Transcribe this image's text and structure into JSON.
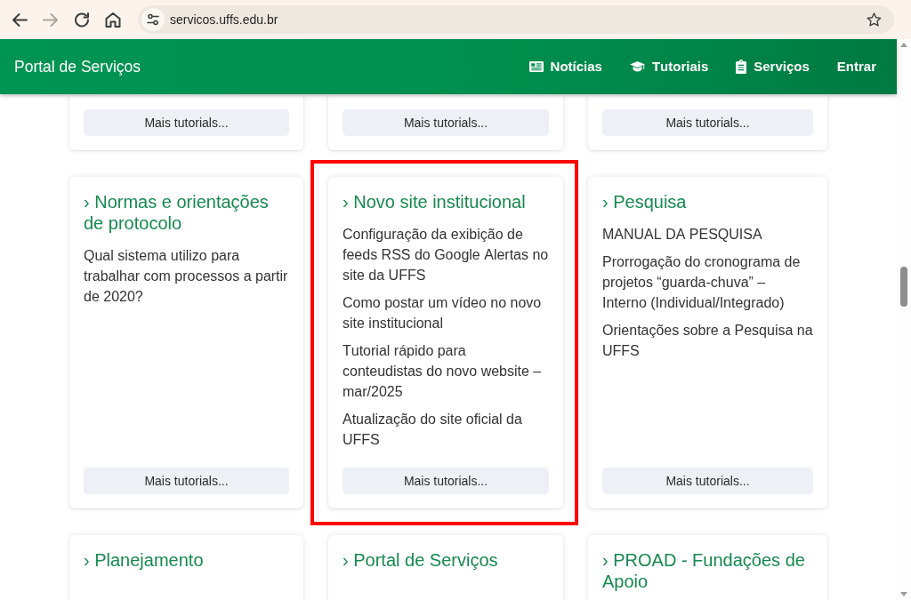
{
  "browser": {
    "nav_buttons": [
      {
        "kind": "back",
        "disabled": false
      },
      {
        "kind": "forward",
        "disabled": true
      },
      {
        "kind": "reload",
        "disabled": false
      },
      {
        "kind": "home",
        "disabled": false
      }
    ],
    "url": "servicos.uffs.edu.br",
    "bookmarked": false
  },
  "navbar": {
    "brand": "Portal de Serviços",
    "links": [
      {
        "label": "Notícias"
      },
      {
        "label": "Tutoriais"
      },
      {
        "label": "Serviços"
      },
      {
        "label": "Entrar"
      }
    ]
  },
  "card_rows": [
    {
      "cards": [
        {
          "button": "Mais tutorials...",
          "highlighted": false
        },
        {
          "button": "Mais tutorials...",
          "highlighted": false
        },
        {
          "button": "Mais tutorials...",
          "highlighted": false
        }
      ]
    },
    {
      "cards": [
        {
          "title": "› Normas e orientações de protocolo",
          "items": [
            "Qual sistema utilizo para trabalhar com processos a partir de 2020?"
          ],
          "button": "Mais tutorials...",
          "highlighted": false
        },
        {
          "title": "› Novo site institucional",
          "items": [
            "Configuração da exibição de feeds RSS do Google Alertas no site da UFFS",
            "Como postar um vídeo no novo site institucional",
            "Tutorial rápido para conteudistas do novo website – mar/2025",
            "Atualização do site oficial da UFFS"
          ],
          "button": "Mais tutorials...",
          "highlighted": true
        },
        {
          "title": "› Pesquisa",
          "items": [
            "MANUAL DA PESQUISA",
            "Prorrogação do cronograma de projetos “guarda-chuva” – Interno (Individual/Integrado)",
            "Orientações sobre a Pesquisa na UFFS"
          ],
          "button": "Mais tutorials...",
          "highlighted": false
        }
      ]
    },
    {
      "cards": [
        {
          "title": "› Planejamento",
          "highlighted": false
        },
        {
          "title": "› Portal de Serviços",
          "highlighted": false
        },
        {
          "title": "› PROAD - Fundações de Apoio",
          "highlighted": false
        }
      ]
    }
  ]
}
